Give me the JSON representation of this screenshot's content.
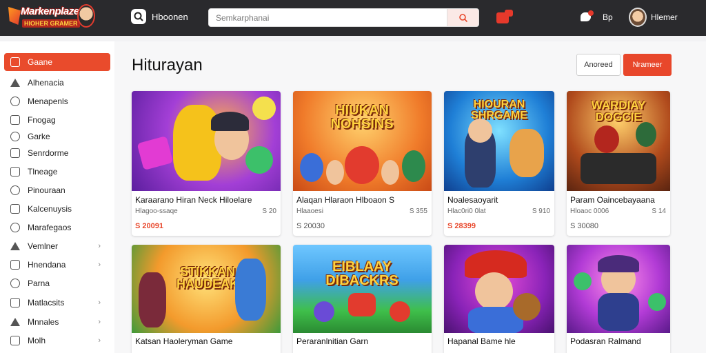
{
  "header": {
    "logo_top": "Markenplaze",
    "logo_bottom": "HIOHER GRAMER",
    "search_label": "Hboonen",
    "search_placeholder": "Semkarphanai",
    "notif_label": "Bp",
    "user_name": "Hlemer"
  },
  "sidebar": {
    "items": [
      {
        "label": "Gaane",
        "active": true
      },
      {
        "label": "Alhenacia"
      },
      {
        "label": "Menapenls"
      },
      {
        "label": "Fnogag"
      },
      {
        "label": "Garke"
      },
      {
        "label": "Senrdorme"
      },
      {
        "label": "Tlneage"
      },
      {
        "label": "Pinouraan"
      },
      {
        "label": "Kalcenuysis"
      },
      {
        "label": "Marafegaos"
      },
      {
        "label": "Vemlner"
      },
      {
        "label": "Hnendana"
      },
      {
        "label": "Parna"
      },
      {
        "label": "Matlacsits"
      },
      {
        "label": "Mnnales"
      },
      {
        "label": "Molh"
      }
    ]
  },
  "main": {
    "title": "Hiturayan",
    "btn_secondary": "Anoreed",
    "btn_primary": "Nrameer",
    "cards": [
      {
        "title": "Karaarano Hiran Neck Hiloelare",
        "meta": "Hlagoo-ssaqe",
        "count": "S 20",
        "price": "S 20091",
        "headline": ""
      },
      {
        "title": "Alaqan Hlaraon Hlboaon S",
        "meta": "Hlaaoesi",
        "count": "S 355",
        "price": "S 20030",
        "headline": "HIUKAN NOHSINS"
      },
      {
        "title": "Noalesaoyarit",
        "meta": "Hlac0ri0 0lat",
        "count": "S 910",
        "price": "S 28399",
        "headline": "HIOURAN SHRGAME"
      },
      {
        "title": "Param Oaincebayaana",
        "meta": "Hloaoc 0006",
        "count": "S 14",
        "price": "S 30080",
        "headline": "WARDIAY DOGCIE"
      },
      {
        "title": "Katsan Haoleryman Game",
        "meta": "",
        "count": "",
        "price": "",
        "headline": "STIKKAN HAUDEAK"
      },
      {
        "title": "Peraranlnitian Garn",
        "meta": "",
        "count": "",
        "price": "",
        "headline": "EIBLAAY DIBACKRS"
      },
      {
        "title": "Hapanal Bame hle",
        "meta": "",
        "count": "",
        "price": "",
        "headline": ""
      },
      {
        "title": "Podasran Ralmand",
        "meta": "",
        "count": "",
        "price": "",
        "headline": ""
      }
    ]
  },
  "colors": {
    "accent": "#e8472b",
    "topbar": "#2a2a2d"
  }
}
